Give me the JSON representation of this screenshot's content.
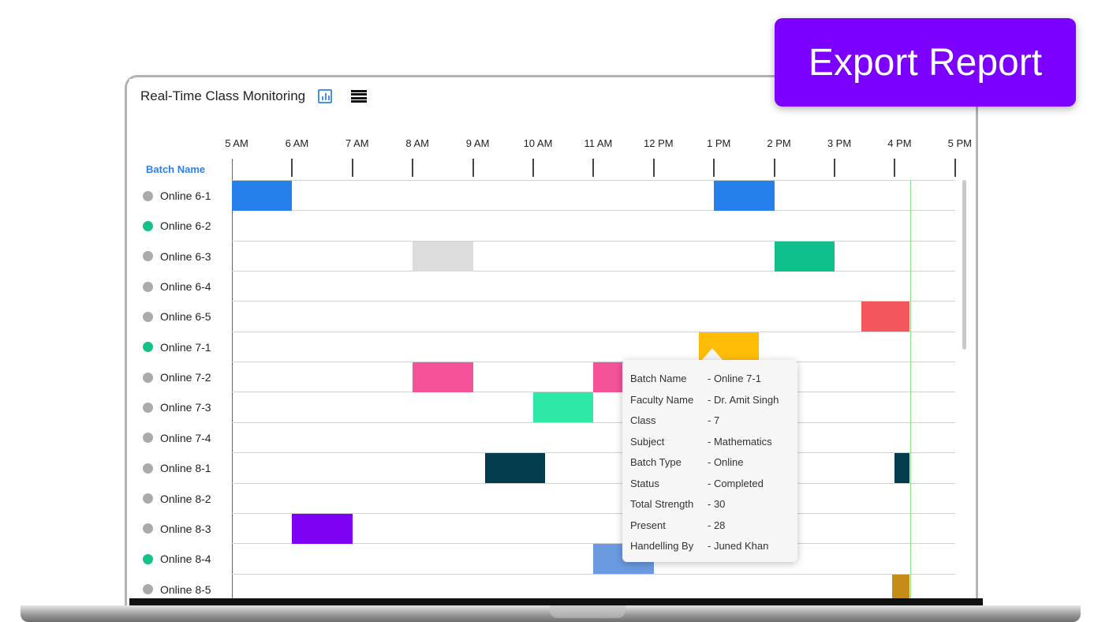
{
  "header": {
    "title": "Real-Time Class Monitoring"
  },
  "timeline": {
    "batch_column_header": "Batch Name",
    "hours": [
      "5 AM",
      "6 AM",
      "7 AM",
      "8 AM",
      "9 AM",
      "10 AM",
      "11 AM",
      "12 PM",
      "1 PM",
      "2 PM",
      "3 PM",
      "4 PM",
      "5 PM"
    ]
  },
  "batches": [
    {
      "label": "Online 6-1",
      "status": "gray"
    },
    {
      "label": "Online 6-2",
      "status": "green"
    },
    {
      "label": "Online 6-3",
      "status": "gray"
    },
    {
      "label": "Online 6-4",
      "status": "gray"
    },
    {
      "label": "Online 6-5",
      "status": "gray"
    },
    {
      "label": "Online 7-1",
      "status": "green"
    },
    {
      "label": "Online 7-2",
      "status": "gray"
    },
    {
      "label": "Online 7-3",
      "status": "gray"
    },
    {
      "label": "Online 7-4",
      "status": "gray"
    },
    {
      "label": "Online 8-1",
      "status": "gray"
    },
    {
      "label": "Online 8-2",
      "status": "gray"
    },
    {
      "label": "Online 8-3",
      "status": "gray"
    },
    {
      "label": "Online 8-4",
      "status": "green"
    },
    {
      "label": "Online 8-5",
      "status": "gray"
    }
  ],
  "sessions": [
    {
      "row": 0,
      "start": 5,
      "end": 6,
      "color": "#2680eb"
    },
    {
      "row": 0,
      "start": 13,
      "end": 14,
      "color": "#2680eb"
    },
    {
      "row": 2,
      "start": 8,
      "end": 9,
      "color": "#dcdcdc"
    },
    {
      "row": 2,
      "start": 14,
      "end": 15,
      "color": "#0fbf8c"
    },
    {
      "row": 4,
      "start": 15.45,
      "end": 16.25,
      "color": "#f5555d"
    },
    {
      "row": 5,
      "start": 12.75,
      "end": 13.75,
      "color": "#ffbd07"
    },
    {
      "row": 6,
      "start": 8,
      "end": 9,
      "color": "#f45399"
    },
    {
      "row": 6,
      "start": 11,
      "end": 11.5,
      "color": "#f45399"
    },
    {
      "row": 7,
      "start": 10,
      "end": 11,
      "color": "#2ee8a6"
    },
    {
      "row": 9,
      "start": 9.2,
      "end": 10.2,
      "color": "#023c4d"
    },
    {
      "row": 9,
      "start": 16,
      "end": 16.25,
      "color": "#023c4d"
    },
    {
      "row": 11,
      "start": 6,
      "end": 7,
      "color": "#7d00f5"
    },
    {
      "row": 12,
      "start": 11,
      "end": 12,
      "color": "#6b9ae0"
    },
    {
      "row": 13,
      "start": 15.95,
      "end": 16.25,
      "color": "#c58d17"
    }
  ],
  "status_colors": {
    "gray": "#aaaaaa",
    "green": "#12c286"
  },
  "current_time": 16.25,
  "tooltip": {
    "rows": [
      {
        "key": "Batch Name",
        "value": "- Online  7-1"
      },
      {
        "key": "Faculty Name",
        "value": "- Dr. Amit Singh"
      },
      {
        "key": "Class",
        "value": "- 7"
      },
      {
        "key": "Subject",
        "value": "- Mathematics"
      },
      {
        "key": "Batch Type",
        "value": "- Online"
      },
      {
        "key": "Status",
        "value": "- Completed"
      },
      {
        "key": "Total Strength",
        "value": "- 30"
      },
      {
        "key": "Present",
        "value": "- 28"
      },
      {
        "key": "Handelling By",
        "value": "- Juned Khan"
      }
    ]
  },
  "export_button": {
    "label": "Export Report",
    "color": "#7b00ff"
  },
  "icons": {
    "chart_toggle": "bar-chart-icon",
    "list_toggle": "list-icon"
  }
}
